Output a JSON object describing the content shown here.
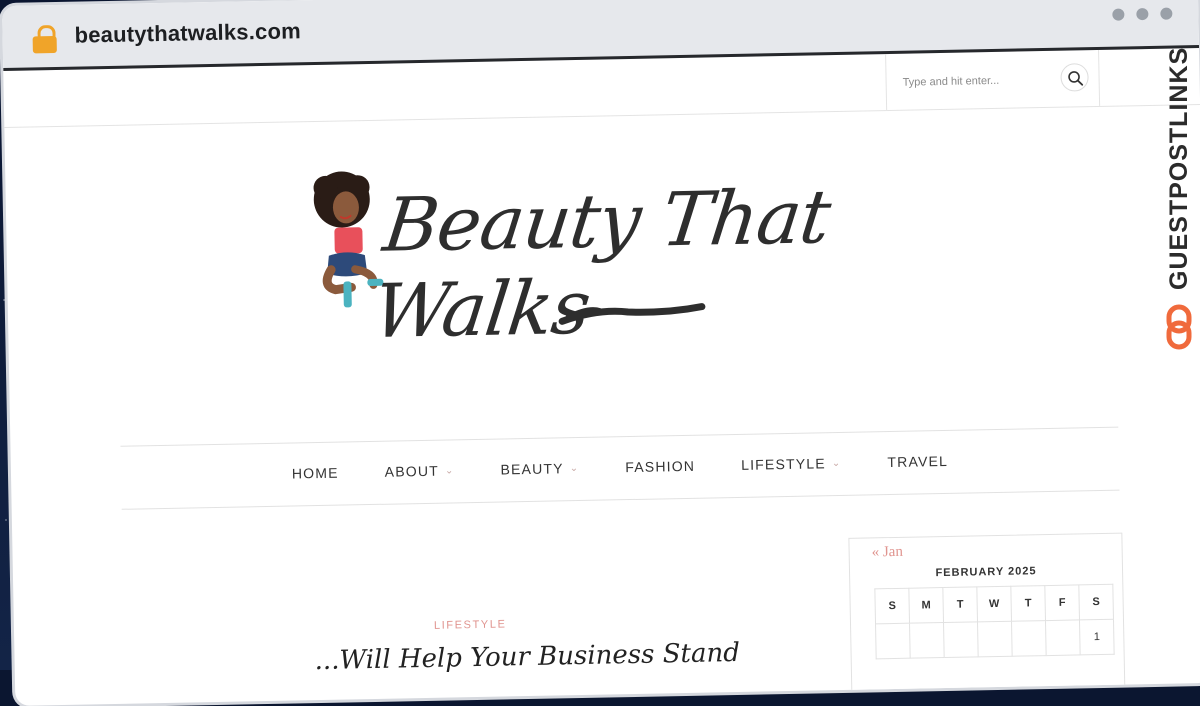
{
  "browser": {
    "url": "beautythatwalks.com",
    "lock_icon": "lock-icon"
  },
  "search": {
    "placeholder": "Type and hit enter...",
    "icon": "search-icon"
  },
  "logo": {
    "text": "Beauty That Walks"
  },
  "nav": {
    "items": [
      {
        "label": "HOME",
        "dropdown": false
      },
      {
        "label": "ABOUT",
        "dropdown": true
      },
      {
        "label": "BEAUTY",
        "dropdown": true
      },
      {
        "label": "FASHION",
        "dropdown": false
      },
      {
        "label": "LIFESTYLE",
        "dropdown": true
      },
      {
        "label": "TRAVEL",
        "dropdown": false
      }
    ]
  },
  "post": {
    "category": "LIFESTYLE",
    "title": "...Will Help Your Business Stand"
  },
  "calendar": {
    "prev_link": "« Jan",
    "caption": "FEBRUARY 2025",
    "weekdays": [
      "S",
      "M",
      "T",
      "W",
      "T",
      "F",
      "S"
    ],
    "rows": [
      [
        "",
        "",
        "",
        "",
        "",
        "",
        "1"
      ]
    ]
  },
  "badge": {
    "text": "GUESTPOSTLINKS",
    "accent": "#f06a3c"
  },
  "colors": {
    "accent_pink": "#e0948f",
    "lock": "#f0a429"
  }
}
